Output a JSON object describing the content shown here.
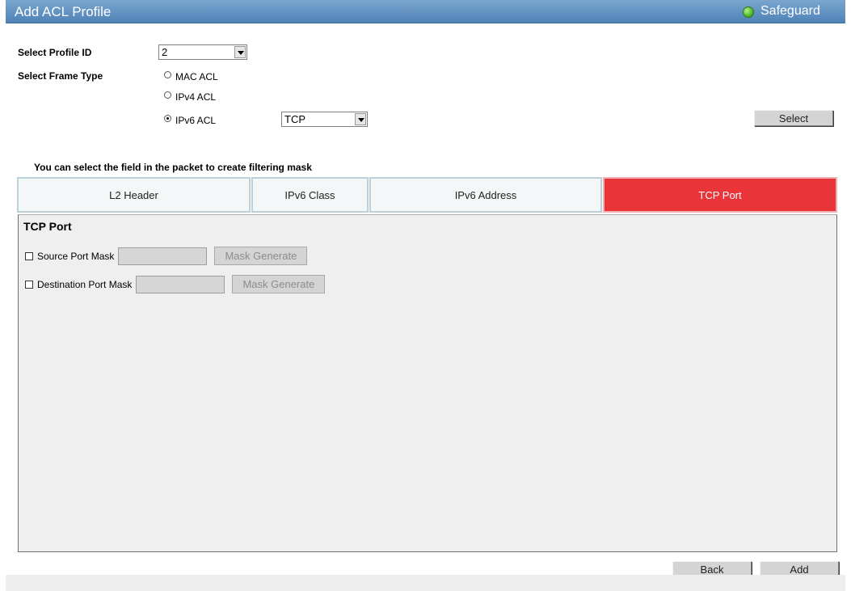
{
  "titlebar": {
    "title": "Add ACL Profile",
    "safeguard_label": "Safeguard",
    "safeguard_color": "#4cb82a"
  },
  "profile": {
    "label": "Select Profile ID",
    "value": "2"
  },
  "frame_type": {
    "label": "Select Frame Type",
    "options": [
      "MAC ACL",
      "IPv4 ACL",
      "IPv6 ACL"
    ],
    "selected": "IPv6 ACL",
    "protocol_value": "TCP"
  },
  "buttons": {
    "select": "Select",
    "back": "Back",
    "add": "Add"
  },
  "hint": "You can select the field in the packet to create filtering mask",
  "tabs": [
    "L2 Header",
    "IPv6 Class",
    "IPv6 Address",
    "TCP Port"
  ],
  "active_tab": "TCP Port",
  "active_tab_color": "#e9343a",
  "panel": {
    "title": "TCP Port",
    "rows": [
      {
        "label": "Source Port Mask",
        "value": "",
        "checked": false,
        "button": "Mask Generate"
      },
      {
        "label": "Destination Port Mask",
        "value": "",
        "checked": false,
        "button": "Mask Generate"
      }
    ]
  }
}
